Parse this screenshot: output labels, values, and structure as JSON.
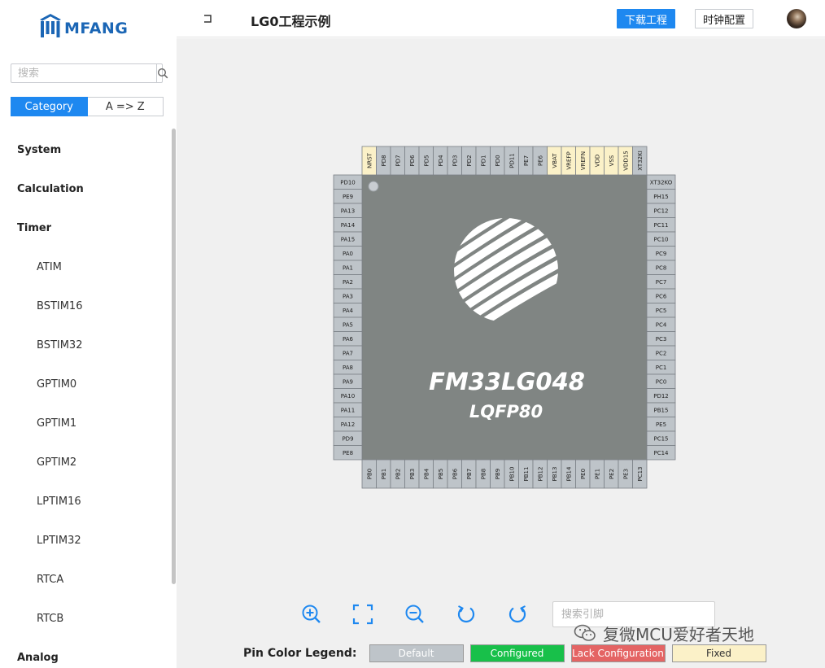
{
  "app": {
    "logo_text": "MFANG"
  },
  "sidebar": {
    "search_placeholder": "搜索",
    "sort_tabs": [
      "Category",
      "A => Z"
    ],
    "items": [
      {
        "label": "System",
        "level": "cat"
      },
      {
        "label": "Calculation",
        "level": "cat"
      },
      {
        "label": "Timer",
        "level": "cat"
      },
      {
        "label": "ATIM",
        "level": "sub"
      },
      {
        "label": "BSTIM16",
        "level": "sub"
      },
      {
        "label": "BSTIM32",
        "level": "sub"
      },
      {
        "label": "GPTIM0",
        "level": "sub"
      },
      {
        "label": "GPTIM1",
        "level": "sub"
      },
      {
        "label": "GPTIM2",
        "level": "sub"
      },
      {
        "label": "LPTIM16",
        "level": "sub"
      },
      {
        "label": "LPTIM32",
        "level": "sub"
      },
      {
        "label": "RTCA",
        "level": "sub"
      },
      {
        "label": "RTCB",
        "level": "sub"
      },
      {
        "label": "Analog",
        "level": "cat"
      }
    ]
  },
  "header": {
    "project_title": "LG0工程示例",
    "download_label": "下载工程",
    "clock_label": "时钟配置"
  },
  "chip": {
    "part_number": "FM33LG048",
    "package": "LQFP80",
    "top_pins": [
      "NRST",
      "PD8",
      "PD7",
      "PD6",
      "PD5",
      "PD4",
      "PD3",
      "PD2",
      "PD1",
      "PD0",
      "PD11",
      "PE7",
      "PE6",
      "VBAT",
      "VREFP",
      "VREFN",
      "VDD",
      "VSS",
      "VDD15",
      "XT32KI"
    ],
    "bottom_pins": [
      "PB0",
      "PB1",
      "PB2",
      "PB3",
      "PB4",
      "PB5",
      "PB6",
      "PB7",
      "PB8",
      "PB9",
      "PB10",
      "PB11",
      "PB12",
      "PB13",
      "PB14",
      "PE0",
      "PE1",
      "PE2",
      "PE3",
      "PC13"
    ],
    "left_pins": [
      "PD10",
      "PE9",
      "PA13",
      "PA14",
      "PA15",
      "PA0",
      "PA1",
      "PA2",
      "PA3",
      "PA4",
      "PA5",
      "PA6",
      "PA7",
      "PA8",
      "PA9",
      "PA10",
      "PA11",
      "PA12",
      "PD9",
      "PE8"
    ],
    "right_pins": [
      "XT32KO",
      "PH15",
      "PC12",
      "PC11",
      "PC10",
      "PC9",
      "PC8",
      "PC7",
      "PC6",
      "PC5",
      "PC4",
      "PC3",
      "PC2",
      "PC1",
      "PC0",
      "PD12",
      "PB15",
      "PE5",
      "PC15",
      "PC14"
    ],
    "fixed_pins": [
      "NRST",
      "VBAT",
      "VREFP",
      "VREFN",
      "VDD",
      "VSS",
      "VDD15"
    ]
  },
  "tools": {
    "zoom_in": "zoom-in-icon",
    "fit": "fit-screen-icon",
    "zoom_out": "zoom-out-icon",
    "rotate_left": "rotate-left-icon",
    "rotate_right": "rotate-right-icon",
    "pin_search_placeholder": "搜索引脚"
  },
  "watermark": "复微MCU爱好者天地",
  "legend": {
    "title": "Pin Color Legend:",
    "items": [
      {
        "label": "Default",
        "bg": "#bec4c9",
        "fg": "#ffffff"
      },
      {
        "label": "Configured",
        "bg": "#18c04a",
        "fg": "#ffffff"
      },
      {
        "label": "Lack Configuration",
        "bg": "#e46464",
        "fg": "#ffffff"
      },
      {
        "label": "Fixed",
        "bg": "#fbf1c8",
        "fg": "#333333"
      }
    ]
  },
  "colors": {
    "accent": "#1e88f0",
    "chip_body": "#808583",
    "pin_default": "#bec4c9",
    "pin_fixed": "#fbf1c8"
  }
}
